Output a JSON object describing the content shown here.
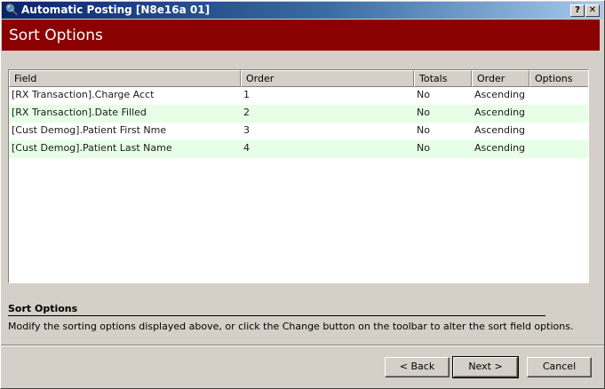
{
  "window": {
    "title": "Automatic Posting [N8e16a 01]",
    "help_label": "?",
    "close_label": "✕",
    "icon_glyph": "🔍"
  },
  "banner": {
    "title": "Sort Options"
  },
  "grid": {
    "columns": [
      "Field",
      "Order",
      "Totals",
      "Order",
      "Options"
    ],
    "rows": [
      {
        "field": "[RX Transaction].Charge Acct",
        "order": "1",
        "totals": "No",
        "sort": "Ascending",
        "options": ""
      },
      {
        "field": "[RX Transaction].Date Filled",
        "order": "2",
        "totals": "No",
        "sort": "Ascending",
        "options": ""
      },
      {
        "field": "[Cust Demog].Patient First Nme",
        "order": "3",
        "totals": "No",
        "sort": "Ascending",
        "options": ""
      },
      {
        "field": "[Cust Demog].Patient Last Name",
        "order": "4",
        "totals": "No",
        "sort": "Ascending",
        "options": ""
      }
    ]
  },
  "info": {
    "title": "Sort Options",
    "description": "Modify the sorting options displayed above, or click the Change button on the toolbar to alter the sort field options."
  },
  "buttons": {
    "back": "< Back",
    "next": "Next >",
    "cancel": "Cancel"
  }
}
